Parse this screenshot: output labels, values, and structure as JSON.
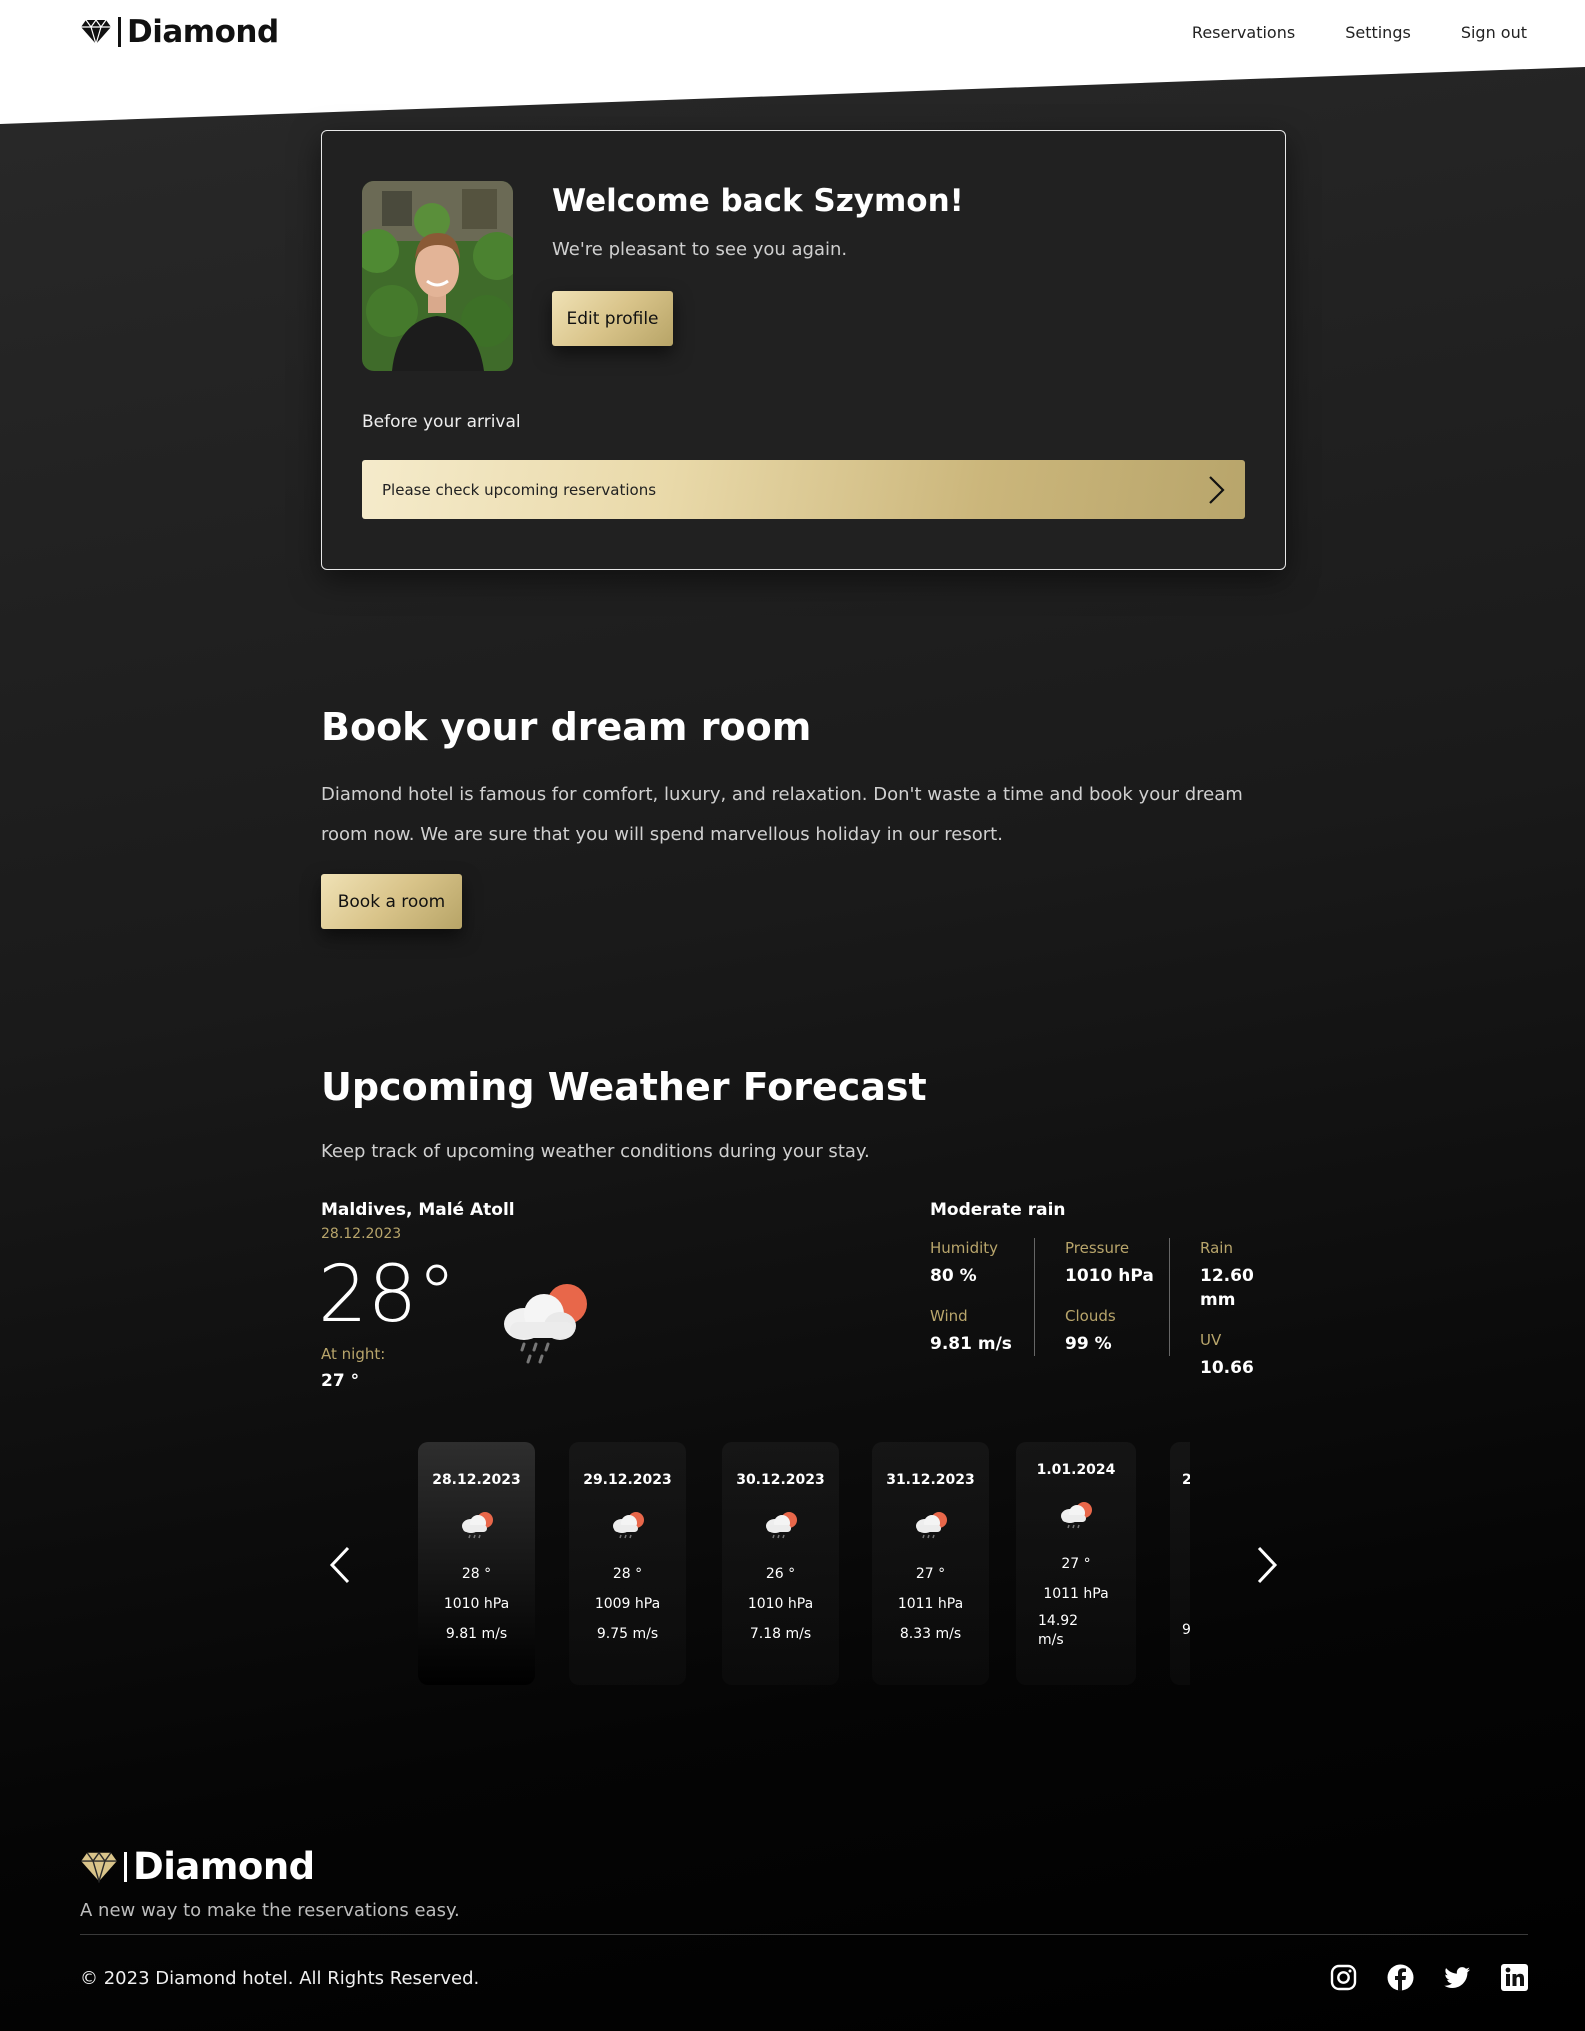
{
  "header": {
    "brand": "Diamond",
    "nav": [
      "Reservations",
      "Settings",
      "Sign out"
    ]
  },
  "welcome": {
    "title": "Welcome back Szymon!",
    "subtitle": "We're pleasant to see you again.",
    "edit_label": "Edit profile",
    "before_label": "Before your arrival",
    "reservations_prompt": "Please check upcoming reservations"
  },
  "booking": {
    "title": "Book your dream room",
    "text": "Diamond hotel is famous for comfort, luxury, and relaxation. Don't waste a time and book your dream room now. We are sure that you will spend marvellous holiday in our resort.",
    "button_label": "Book a room"
  },
  "weather": {
    "title": "Upcoming Weather Forecast",
    "subtitle": "Keep track of upcoming weather conditions during your stay.",
    "location": "Maldives, Malé Atoll",
    "date": "28.12.2023",
    "temperature": "28°",
    "night_label": "At night:",
    "night_value": "27 °",
    "condition": "Moderate rain",
    "stats": {
      "humidity_label": "Humidity",
      "humidity": "80 %",
      "wind_label": "Wind",
      "wind": "9.81 m/s",
      "pressure_label": "Pressure",
      "pressure": "1010 hPa",
      "clouds_label": "Clouds",
      "clouds": "99 %",
      "rain_label": "Rain",
      "rain": "12.60 mm",
      "uv_label": "UV",
      "uv": "10.66"
    },
    "days": [
      {
        "date": "28.12.2023",
        "temp": "28 °",
        "pressure": "1010 hPa",
        "wind": "9.81 m/s"
      },
      {
        "date": "29.12.2023",
        "temp": "28 °",
        "pressure": "1009 hPa",
        "wind": "9.75 m/s"
      },
      {
        "date": "30.12.2023",
        "temp": "26 °",
        "pressure": "1010 hPa",
        "wind": "7.18 m/s"
      },
      {
        "date": "31.12.2023",
        "temp": "27 °",
        "pressure": "1011 hPa",
        "wind": "8.33 m/s"
      },
      {
        "date": "1.01.2024",
        "temp": "27 °",
        "pressure": "1011 hPa",
        "wind": "14.92 m/s"
      },
      {
        "date": "2",
        "temp": "",
        "pressure": "",
        "wind": "9"
      }
    ]
  },
  "footer": {
    "brand": "Diamond",
    "tagline": "A new way to make the reservations easy.",
    "copyright": "© 2023 Diamond hotel. All Rights Reserved.",
    "socials": [
      "instagram-icon",
      "facebook-icon",
      "twitter-icon",
      "linkedin-icon"
    ]
  },
  "colors": {
    "gold": "#b8a56b",
    "gold_light": "#f0e2b6",
    "sun": "#e8674a"
  }
}
